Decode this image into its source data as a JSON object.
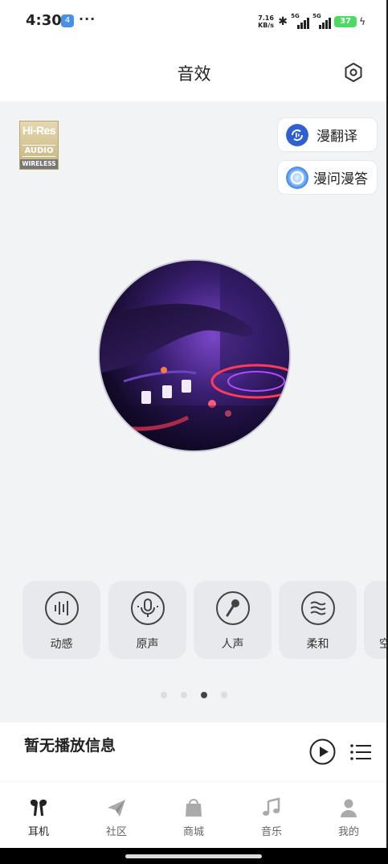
{
  "status_bar": {
    "time": "4:30",
    "notification_badge": "4",
    "overflow": "···",
    "net_speed_value": "7.16",
    "net_speed_unit": "KB/s",
    "sim1_label": "5G",
    "sim2_label": "5G",
    "battery": "37"
  },
  "header": {
    "title": "音效",
    "settings_icon": "settings-hexagon-icon"
  },
  "hires_badge": {
    "line1": "Hi-Res",
    "line2": "AUDIO",
    "line3": "WIRELESS"
  },
  "ai_buttons": [
    {
      "label": "漫翻译",
      "icon": "translate-icon",
      "color": "#2f5fd0"
    },
    {
      "label": "漫问漫答",
      "icon": "ai-ring-icon",
      "color": "#5aa8ff"
    }
  ],
  "presets": [
    {
      "label": "动感",
      "icon": "equalizer-bars-icon"
    },
    {
      "label": "原声",
      "icon": "microphone-icon"
    },
    {
      "label": "人声",
      "icon": "handheld-mic-icon"
    },
    {
      "label": "柔和",
      "icon": "wave-lines-icon"
    },
    {
      "label": "空",
      "icon": "spatial-icon"
    }
  ],
  "page_indicator": {
    "count": 4,
    "active_index": 2
  },
  "now_playing": {
    "text": "暂无播放信息",
    "play_icon": "play-icon",
    "list_icon": "playlist-icon"
  },
  "tabs": [
    {
      "label": "耳机",
      "icon": "earbuds-icon",
      "active": true
    },
    {
      "label": "社区",
      "icon": "paper-plane-icon",
      "active": false
    },
    {
      "label": "商城",
      "icon": "shopping-bag-icon",
      "active": false
    },
    {
      "label": "音乐",
      "icon": "music-note-icon",
      "active": false
    },
    {
      "label": "我的",
      "icon": "person-icon",
      "active": false
    }
  ],
  "colors": {
    "background": "#f2f3f5",
    "active_dot": "#444444",
    "battery": "#4cd964",
    "disc_purple": "#7a47c9",
    "disc_neon_red": "#ff3b5c"
  }
}
